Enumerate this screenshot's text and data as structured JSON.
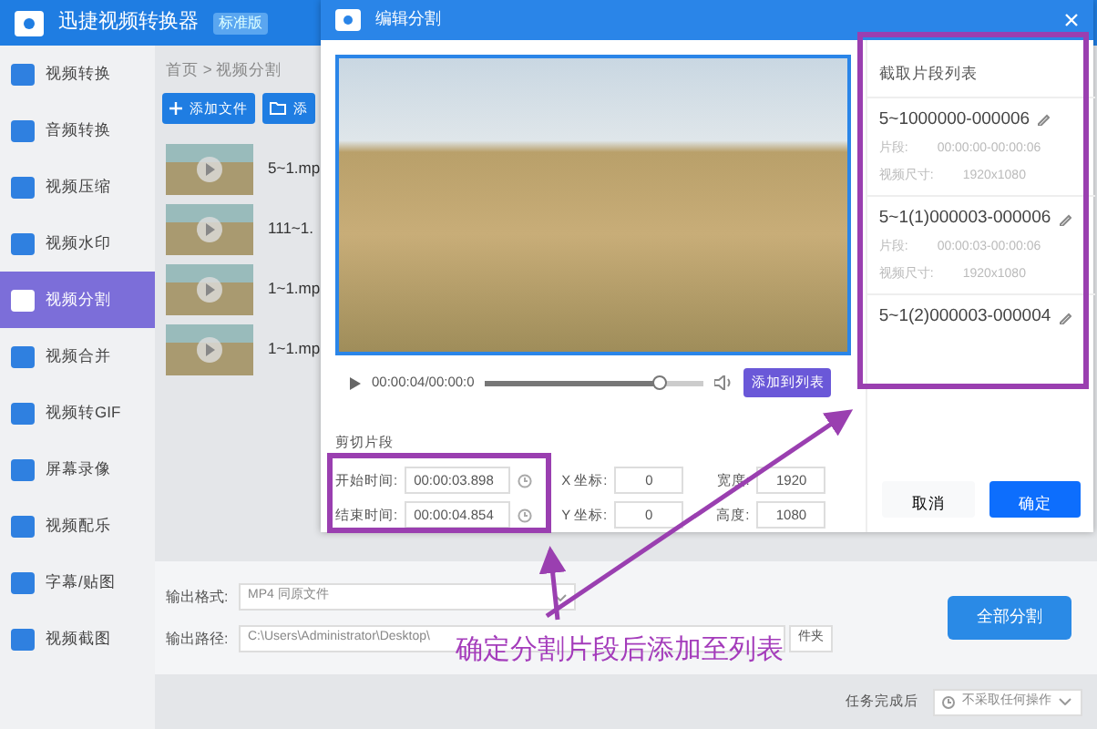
{
  "app": {
    "title": "迅捷视频转换器",
    "edition": "标准版"
  },
  "sidebar": [
    {
      "label": "视频转换",
      "selected": false
    },
    {
      "label": "音频转换",
      "selected": false
    },
    {
      "label": "视频压缩",
      "selected": false
    },
    {
      "label": "视频水印",
      "selected": false
    },
    {
      "label": "视频分割",
      "selected": true
    },
    {
      "label": "视频合并",
      "selected": false
    },
    {
      "label": "视频转GIF",
      "selected": false
    },
    {
      "label": "屏幕录像",
      "selected": false
    },
    {
      "label": "视频配乐",
      "selected": false
    },
    {
      "label": "字幕/贴图",
      "selected": false
    },
    {
      "label": "视频截图",
      "selected": false
    }
  ],
  "breadcrumb": "首页 > 视频分割",
  "toolbar": [
    {
      "label": "添加文件",
      "kind": "plus"
    },
    {
      "label": "添",
      "kind": "folder"
    }
  ],
  "files": [
    {
      "name": "5~1.mp"
    },
    {
      "name": "111~1."
    },
    {
      "name": "1~1.mp"
    },
    {
      "name": "1~1.mp"
    }
  ],
  "dialog": {
    "title": "编辑分割",
    "player": {
      "time": "00:00:04/00:00:0",
      "level": 0.8,
      "add_button": "添加到列表"
    },
    "clip": {
      "heading": "剪切片段",
      "fields": [
        {
          "label": "开始时间:",
          "value": "00:00:03.898"
        },
        {
          "label": "结束时间:",
          "value": "00:00:04.854"
        }
      ]
    },
    "crop": [
      {
        "label": "X 坐标:",
        "value": "0"
      },
      {
        "label": "宽度:",
        "value": "1920"
      },
      {
        "label": "Y 坐标:",
        "value": "0"
      },
      {
        "label": "高度:",
        "value": "1080"
      }
    ],
    "list": {
      "title": "截取片段列表",
      "items": [
        {
          "name": "5~1000000-000006",
          "range_label": "片段:",
          "range": "00:00:00-00:00:06",
          "size_label": "视频尺寸:",
          "size": "1920x1080"
        },
        {
          "name": "5~1(1)000003-000006",
          "range_label": "片段:",
          "range": "00:00:03-00:00:06",
          "size_label": "视频尺寸:",
          "size": "1920x1080"
        },
        {
          "name": "5~1(2)000003-000004"
        }
      ]
    },
    "buttons": [
      {
        "label": "取消",
        "kind": "secondary"
      },
      {
        "label": "确定",
        "kind": "primary"
      }
    ]
  },
  "output": {
    "format_label": "输出格式:",
    "format": "MP4 同原文件",
    "path_label": "输出路径:",
    "path": "C:\\Users\\Administrator\\Desktop\\",
    "folder_button": "件夹",
    "run_button": "全部分割"
  },
  "footer": {
    "label": "任务完成后",
    "select": "不采取任何操作"
  },
  "annotation": "确定分割片段后添加至列表"
}
